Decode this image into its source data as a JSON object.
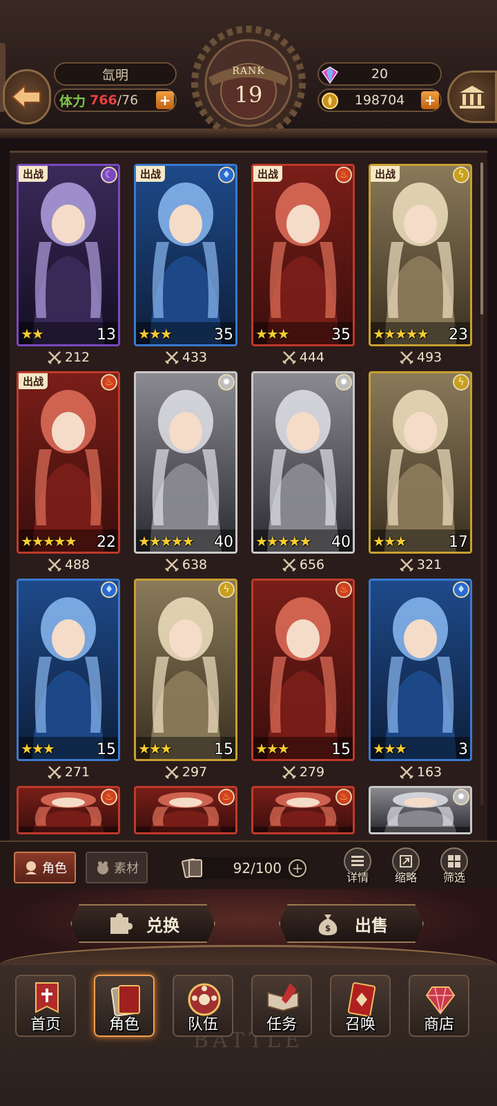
{
  "player": {
    "name": "氙明"
  },
  "stamina": {
    "label": "体力",
    "current": "766",
    "max": "/76"
  },
  "rank": {
    "label": "RANK",
    "value": "19"
  },
  "currency": {
    "gems": "20",
    "gold": "198704"
  },
  "deploy_label": "出战",
  "cards": [
    {
      "stars": "★★",
      "level": "13",
      "power": "212",
      "element": "dark",
      "deployed": true,
      "frame": "#7a4ac0"
    },
    {
      "stars": "★★★",
      "level": "35",
      "power": "433",
      "element": "water",
      "deployed": true,
      "frame": "#3a7ad0"
    },
    {
      "stars": "★★★",
      "level": "35",
      "power": "444",
      "element": "fire",
      "deployed": true,
      "frame": "#c03a2a"
    },
    {
      "stars": "★★★★★",
      "level": "23",
      "power": "493",
      "element": "light",
      "deployed": true,
      "frame": "#c8a030"
    },
    {
      "stars": "★★★★★",
      "level": "22",
      "power": "488",
      "element": "fire",
      "deployed": true,
      "frame": "#c03a2a"
    },
    {
      "stars": "★★★★★",
      "level": "40",
      "power": "638",
      "element": "neutral",
      "deployed": false,
      "frame": "#c8c8c8"
    },
    {
      "stars": "★★★★★",
      "level": "40",
      "power": "656",
      "element": "neutral",
      "deployed": false,
      "frame": "#c8c8c8"
    },
    {
      "stars": "★★★",
      "level": "17",
      "power": "321",
      "element": "light",
      "deployed": false,
      "frame": "#c8a030"
    },
    {
      "stars": "★★★",
      "level": "15",
      "power": "271",
      "element": "water",
      "deployed": false,
      "frame": "#3a7ad0"
    },
    {
      "stars": "★★★",
      "level": "15",
      "power": "297",
      "element": "light",
      "deployed": false,
      "frame": "#c8a030"
    },
    {
      "stars": "★★★",
      "level": "15",
      "power": "279",
      "element": "fire",
      "deployed": false,
      "frame": "#c03a2a"
    },
    {
      "stars": "★★★",
      "level": "3",
      "power": "163",
      "element": "water",
      "deployed": false,
      "frame": "#3a7ad0"
    },
    {
      "stars": "",
      "level": "",
      "power": "",
      "element": "fire",
      "deployed": false,
      "frame": "#c03a2a"
    },
    {
      "stars": "",
      "level": "",
      "power": "",
      "element": "fire",
      "deployed": false,
      "frame": "#c03a2a"
    },
    {
      "stars": "",
      "level": "",
      "power": "",
      "element": "fire",
      "deployed": false,
      "frame": "#c03a2a"
    },
    {
      "stars": "",
      "level": "",
      "power": "",
      "element": "neutral",
      "deployed": false,
      "frame": "#c8c8c8"
    }
  ],
  "filters": {
    "tab_character": "角色",
    "tab_material": "素材",
    "capacity": "92/100",
    "details": "详情",
    "compact": "缩略",
    "filter": "筛选"
  },
  "actions": {
    "exchange": "兑换",
    "sell": "出售"
  },
  "nav": [
    {
      "label": "首页",
      "icon": "banner-icon"
    },
    {
      "label": "角色",
      "icon": "character-card-icon"
    },
    {
      "label": "队伍",
      "icon": "team-icon"
    },
    {
      "label": "任务",
      "icon": "quest-book-icon"
    },
    {
      "label": "召唤",
      "icon": "summon-card-icon"
    },
    {
      "label": "商店",
      "icon": "shop-gem-icon"
    }
  ],
  "nav_watermark": "BATTLE"
}
